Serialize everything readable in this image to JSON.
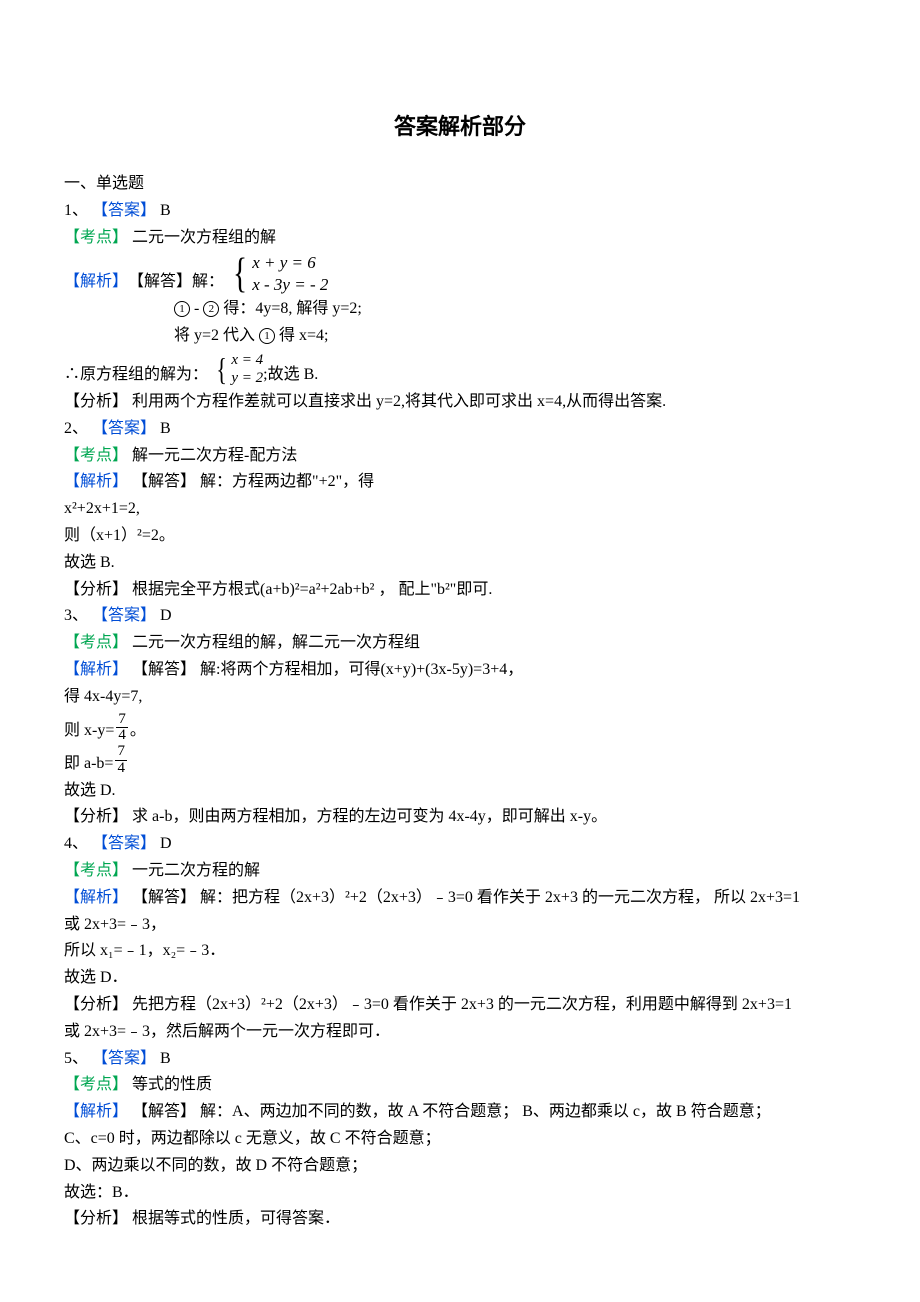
{
  "title": "答案解析部分",
  "section_heading": "一、单选题",
  "q1": {
    "num_label": "1、",
    "ans_tag": "【答案】",
    "ans": "B",
    "kd_tag": "【考点】",
    "kd": "二元一次方程组的解",
    "jx_tag": "【解析】",
    "jd_tag": "【解答】",
    "lead": "解：",
    "eq_top": "x + y = 6",
    "eq_bot": "x - 3y = - 2",
    "step1a": "-",
    "step1b": "得：4y=8,  解得 y=2;",
    "step2a": "将 y=2 代入 ",
    "step2b": "得 x=4;",
    "sol_prefix": "∴原方程组的解为：",
    "sol_top": "x = 4",
    "sol_bot": "y = 2",
    "sol_suffix": " ;故选 B.",
    "analysis_tag": "【分析】",
    "analysis": "利用两个方程作差就可以直接求出 y=2,将其代入即可求出 x=4,从而得出答案."
  },
  "q2": {
    "num_label": "2、",
    "ans_tag": "【答案】",
    "ans": "B",
    "kd_tag": "【考点】",
    "kd": "解一元二次方程-配方法",
    "jx_tag": "【解析】",
    "jd_tag": "【解答】",
    "body": "解：方程两边都\"+2\"，得",
    "line2": "x²+2x+1=2,",
    "line3": "则（x+1）²=2。",
    "line4": "故选 B.",
    "analysis_tag": "【分析】",
    "analysis": "根据完全平方根式(a+b)²=a²+2ab+b²    ，  配上\"b²\"即可."
  },
  "q3": {
    "num_label": "3、",
    "ans_tag": "【答案】",
    "ans": "D",
    "kd_tag": "【考点】",
    "kd": "二元一次方程组的解，解二元一次方程组",
    "jx_tag": "【解析】",
    "jd_tag": "【解答】",
    "body": "解:将两个方程相加，可得(x+y)+(3x-5y)=3+4，",
    "line2": "得 4x-4y=7,",
    "line3_pre": "则 x-y=",
    "frac_num": "7",
    "frac_den": "4",
    "line3_suf": " 。",
    "line4_pre": "即 a-b=",
    "line5": "故选 D.",
    "analysis_tag": "【分析】",
    "analysis": "求 a-b，则由两方程相加，方程的左边可变为 4x-4y，即可解出 x-y。"
  },
  "q4": {
    "num_label": "4、",
    "ans_tag": "【答案】",
    "ans": "D",
    "kd_tag": "【考点】",
    "kd": "一元二次方程的解",
    "jx_tag": "【解析】",
    "jd_tag": "【解答】",
    "body": "解：把方程（2x+3）²+2（2x+3）﹣3=0 看作关于 2x+3 的一元二次方程，   所以 2x+3=1",
    "line2": "或 2x+3=﹣3，",
    "line3": "所以 x₁=﹣1，x₂=﹣3．",
    "line4": "故选 D．",
    "analysis_tag": "【分析】",
    "analysis1": "先把方程（2x+3）²+2（2x+3）﹣3=0 看作关于 2x+3 的一元二次方程，利用题中解得到 2x+3=1",
    "analysis2": "或 2x+3=﹣3，然后解两个一元一次方程即可．"
  },
  "q5": {
    "num_label": "5、",
    "ans_tag": "【答案】",
    "ans": "B",
    "kd_tag": "【考点】",
    "kd": "等式的性质",
    "jx_tag": "【解析】",
    "jd_tag": "【解答】",
    "body": "解：A、两边加不同的数，故 A 不符合题意；   B、两边都乘以 c，故 B 符合题意；",
    "line2": "C、c=0 时，两边都除以 c 无意义，故 C 不符合题意；",
    "line3": "D、两边乘以不同的数，故 D 不符合题意；",
    "line4": "故选：B．",
    "analysis_tag": "【分析】",
    "analysis": "根据等式的性质，可得答案．"
  }
}
